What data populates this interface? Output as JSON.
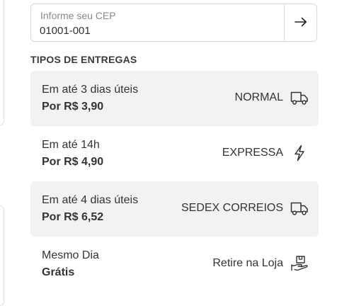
{
  "cep": {
    "label": "Informe seu CEP",
    "value": "01001-001",
    "submit_icon": "arrow-right-icon"
  },
  "delivery": {
    "section_title": "TIPOS DE ENTREGAS",
    "options": [
      {
        "time": "Em até 3 dias úteis",
        "price": "Por R$ 3,90",
        "name": "NORMAL",
        "icon": "truck-icon"
      },
      {
        "time": "Em até 14h",
        "price": "Por R$ 4,90",
        "name": "EXPRESSA",
        "icon": "lightning-icon"
      },
      {
        "time": "Em até 4 dias úteis",
        "price": "Por R$ 6,52",
        "name": "SEDEX CORREIOS",
        "icon": "truck-icon"
      },
      {
        "time": "Mesmo Dia",
        "price": "Grátis",
        "name": "Retire na Loja",
        "icon": "hand-package-icon"
      }
    ]
  }
}
